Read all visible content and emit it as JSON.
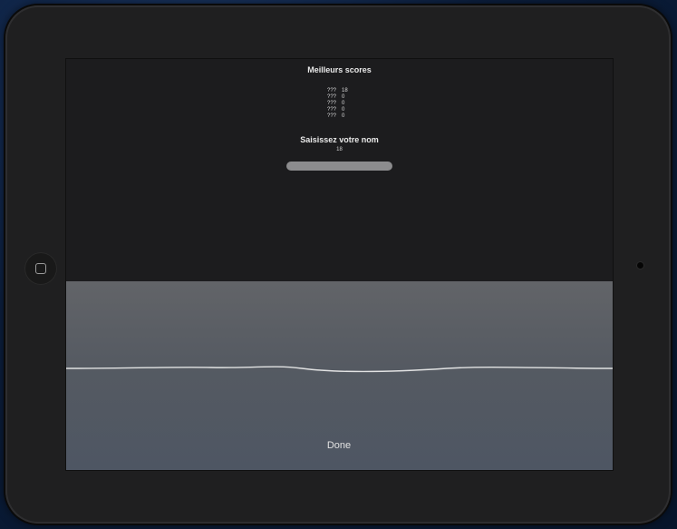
{
  "scores_screen": {
    "title": "Meilleurs scores",
    "high_scores": [
      {
        "name": "???",
        "score": "18"
      },
      {
        "name": "???",
        "score": "0"
      },
      {
        "name": "???",
        "score": "0"
      },
      {
        "name": "???",
        "score": "0"
      },
      {
        "name": "???",
        "score": "0"
      }
    ],
    "prompt": "Saisissez votre nom",
    "current_score": "18",
    "name_input": {
      "value": "",
      "placeholder": ""
    }
  },
  "keyboard": {
    "done_label": "Done"
  },
  "colors": {
    "screen_bg": "#1c1c1e",
    "keyboard_bg": "#55595f",
    "bezel": "#1f1f20"
  }
}
